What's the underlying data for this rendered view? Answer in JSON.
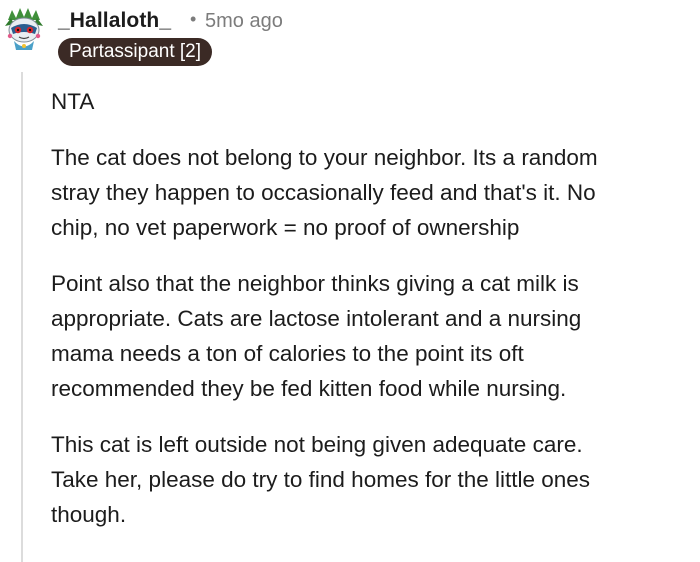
{
  "comment": {
    "username": "_Hallaloth_",
    "separator": "•",
    "timestamp": "5mo ago",
    "flair": "Partassipant [2]",
    "paragraphs": [
      "NTA",
      "The cat does not belong to your neighbor. Its a random\nstray they happen to occasionally feed and that's it. No\nchip, no vet paperwork = no proof of ownership",
      "Point also that the neighbor thinks giving a cat milk is\nappropriate. Cats are lactose intolerant and a nursing\nmama needs a ton of calories to the point its oft\nrecommended they be fed kitten food while nursing.",
      "This cat is left outside not being given adequate care.\nTake her, please do try to find homes for the little ones\nthough."
    ]
  },
  "colors": {
    "flair_background": "#3b2a25",
    "flair_text": "#ffffff",
    "meta_text": "#7c7c7c",
    "thread_line": "#dcdcdc"
  },
  "icons": {
    "avatar": "snoo-avatar-icon"
  }
}
